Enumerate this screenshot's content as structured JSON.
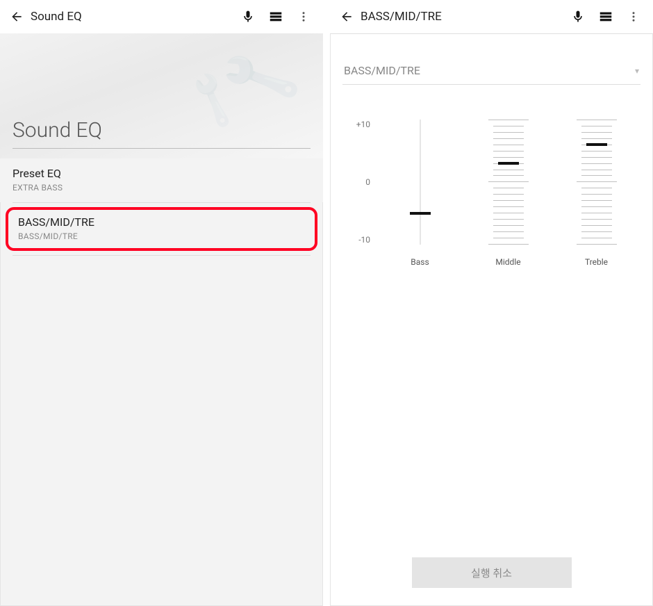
{
  "left": {
    "title_bar": "Sound EQ",
    "header_title": "Sound EQ",
    "items": [
      {
        "title": "Preset EQ",
        "sub": "EXTRA BASS"
      },
      {
        "title": "BASS/MID/TRE",
        "sub": "BASS/MID/TRE"
      }
    ]
  },
  "right": {
    "title_bar": "BASS/MID/TRE",
    "dropdown_label": "BASS/MID/TRE",
    "axis": {
      "max": "+10",
      "mid": "0",
      "min": "-10"
    },
    "sliders": [
      {
        "name": "Bass",
        "value": -5
      },
      {
        "name": "Middle",
        "value": 3
      },
      {
        "name": "Treble",
        "value": 6
      }
    ],
    "footer_button": "실행 취소"
  }
}
